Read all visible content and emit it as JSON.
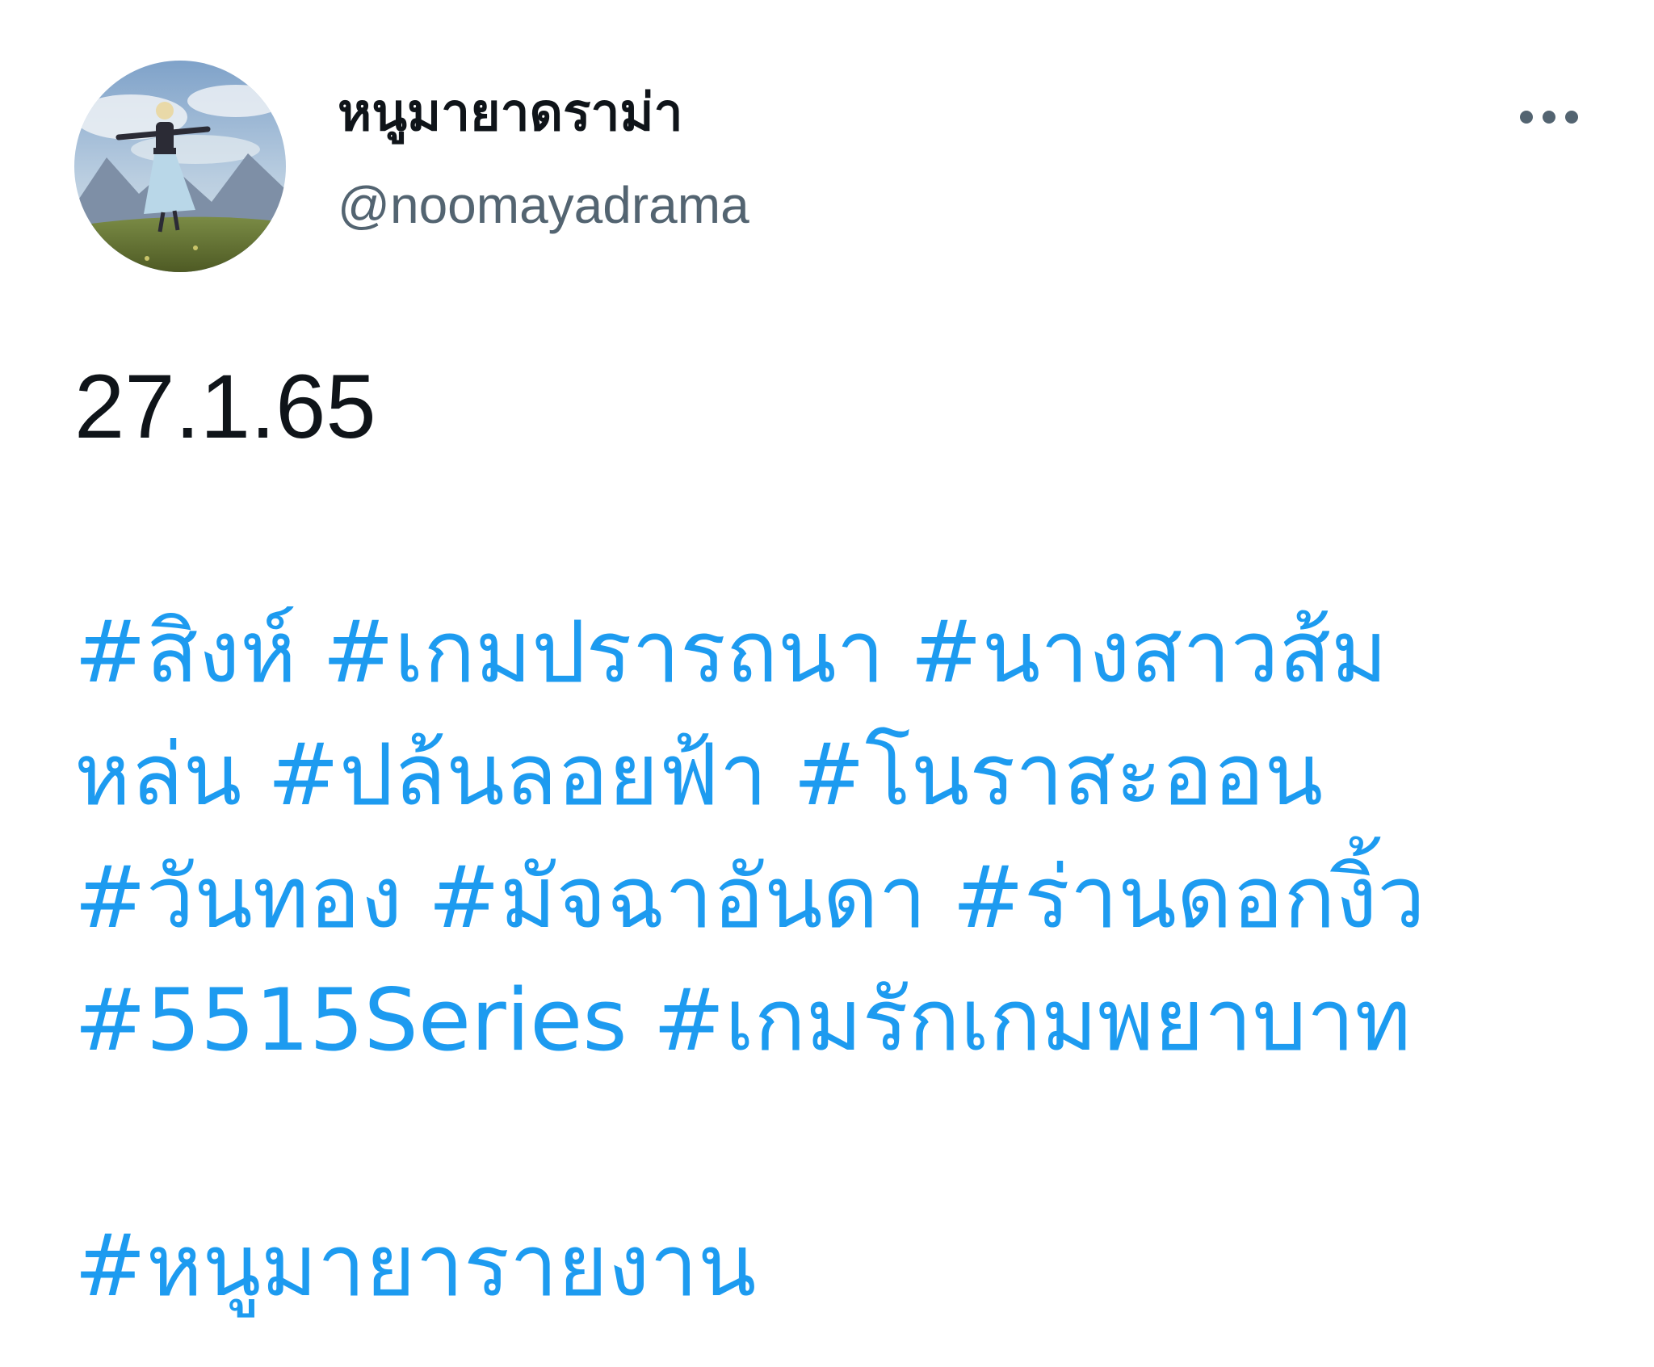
{
  "author": {
    "display_name": "หนูมายาดราม่า",
    "handle": "@noomayadrama",
    "avatar_icon": "avatar-sound-of-music-image"
  },
  "more_icon": "more-horizontal-icon",
  "colors": {
    "text": "#0f1419",
    "secondary": "#536471",
    "link": "#1d9bf0"
  },
  "tweet": {
    "date_text": "27.1.65",
    "hashtag_lines": [
      [
        "#สิงห์",
        "#เกมปรารถนา",
        "#นางสาวส้ม"
      ],
      [
        "หล่น",
        "#ปล้นลอยฟ้า",
        "#โนราสะออน"
      ],
      [
        "#วันทอง",
        "#มัจฉาอันดา",
        "#ร่านดอกงิ้ว"
      ],
      [
        "#5515Series",
        "#เกมรักเกมพยาบาท"
      ]
    ],
    "footer_hashtag": "#หนูมายารายงาน"
  }
}
